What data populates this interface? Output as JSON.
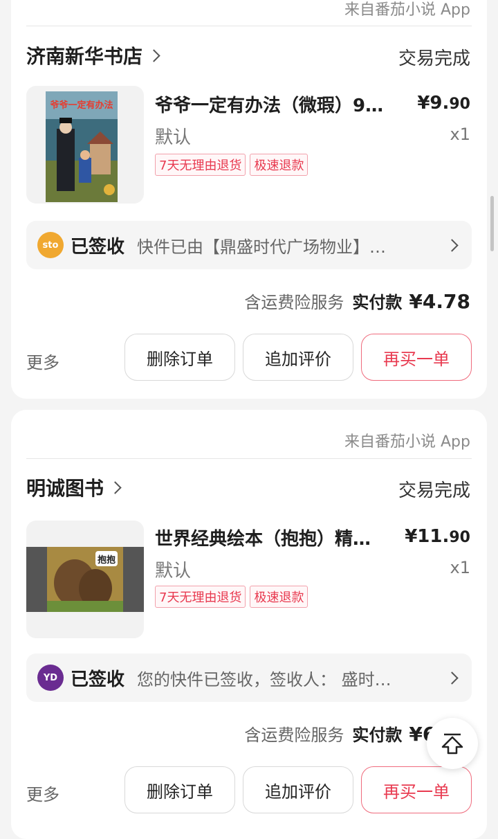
{
  "orders": [
    {
      "source": "来自番茄小说 App",
      "shop": "济南新华书店",
      "status": "交易完成",
      "product": {
        "title": "爷爷一定有办法（微瑕）9…",
        "price_int": "¥9.",
        "price_dec": "90",
        "variant": "默认",
        "qty": "x1",
        "tags": [
          "7天无理由退货",
          "极速退款"
        ]
      },
      "logistics": {
        "carrier_icon": "sto-express-logo",
        "carrier_logo_text": "sto",
        "status": "已签收",
        "message": "快件已由【鼎盛时代广场物业】…"
      },
      "payment": {
        "service": "含运费险服务",
        "label": "实付款",
        "amount": "¥4.78"
      },
      "actions": {
        "more": "更多",
        "delete": "删除订单",
        "review": "追加评价",
        "rebuy": "再买一单"
      }
    },
    {
      "source": "来自番茄小说 App",
      "shop": "明诚图书",
      "status": "交易完成",
      "product": {
        "title": "世界经典绘本（抱抱）精…",
        "price_int": "¥11.",
        "price_dec": "90",
        "variant": "默认",
        "qty": "x1",
        "tags": [
          "7天无理由退货",
          "极速退款"
        ]
      },
      "logistics": {
        "carrier_icon": "yunda-express-logo",
        "carrier_logo_text": "YD",
        "status": "已签收",
        "message": "您的快件已签收，签收人： 盛时…"
      },
      "payment": {
        "service": "含运费险服务",
        "label": "实付款",
        "amount": "¥6.35"
      },
      "actions": {
        "more": "更多",
        "delete": "删除订单",
        "review": "追加评价",
        "rebuy": "再买一单"
      }
    }
  ],
  "colors": {
    "accent": "#e8394f",
    "sto": "#f0a830",
    "yunda": "#6a2c91"
  }
}
